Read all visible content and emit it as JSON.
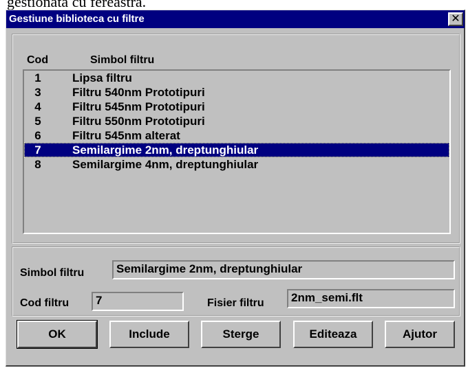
{
  "caption": "gestionata cu fereastra.",
  "window": {
    "title": "Gestiune biblioteca cu filtre",
    "close_glyph": "✕"
  },
  "list": {
    "headers": {
      "cod": "Cod",
      "simbol": "Simbol filtru"
    },
    "selected_index": 5,
    "rows": [
      {
        "cod": "1",
        "simbol": "Lipsa filtru"
      },
      {
        "cod": "3",
        "simbol": "Filtru 540nm Prototipuri"
      },
      {
        "cod": "4",
        "simbol": "Filtru 545nm Prototipuri"
      },
      {
        "cod": "5",
        "simbol": "Filtru 550nm Prototipuri"
      },
      {
        "cod": "6",
        "simbol": "Filtru 545nm alterat"
      },
      {
        "cod": "7",
        "simbol": "Semilargime 2nm, dreptunghiular"
      },
      {
        "cod": "8",
        "simbol": "Semilargime 4nm, dreptunghiular"
      }
    ]
  },
  "form": {
    "simbol_label": "Simbol filtru",
    "simbol_value": "Semilargime 2nm, dreptunghiular",
    "cod_label": "Cod filtru",
    "cod_value": "7",
    "fisier_label": "Fisier filtru",
    "fisier_value": "2nm_semi.flt"
  },
  "buttons": {
    "ok": "OK",
    "include": "Include",
    "sterge": "Sterge",
    "editeaza": "Editeaza",
    "ajutor": "Ajutor"
  },
  "colors": {
    "titlebar": "#000080",
    "face": "#c0c0c0",
    "selection": "#000080"
  }
}
